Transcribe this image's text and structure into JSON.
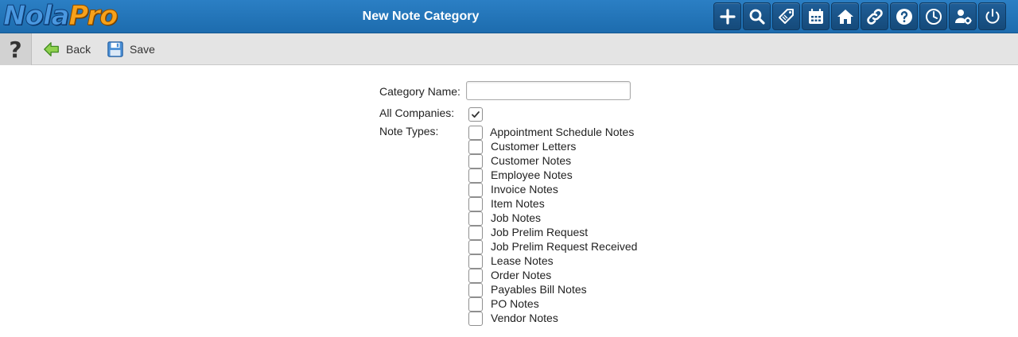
{
  "header": {
    "logo_part1": "Nola",
    "logo_part2": "Pro",
    "title": "New Note Category",
    "icons": [
      "plus-icon",
      "search-icon",
      "tags-icon",
      "calendar-icon",
      "home-icon",
      "link-icon",
      "question-icon",
      "clock-icon",
      "user-settings-icon",
      "power-icon"
    ]
  },
  "subbar": {
    "help_glyph": "?",
    "back_label": "Back",
    "save_label": "Save"
  },
  "form": {
    "category_name_label": "Category Name:",
    "category_name_value": "",
    "all_companies_label": "All Companies:",
    "all_companies_checked": true,
    "note_types_label": "Note Types:",
    "note_types": [
      "Appointment Schedule Notes",
      "Customer Letters",
      "Customer Notes",
      "Employee Notes",
      "Invoice Notes",
      "Item Notes",
      "Job Notes",
      "Job Prelim Request",
      "Job Prelim Request Received",
      "Lease Notes",
      "Order Notes",
      "Payables Bill Notes",
      "PO Notes",
      "Vendor Notes"
    ]
  },
  "colors": {
    "header_bg": "#2277bb",
    "subbar_bg": "#e4e4e4",
    "logo_blue": "#4a98e0",
    "logo_orange": "#f7a11a"
  }
}
